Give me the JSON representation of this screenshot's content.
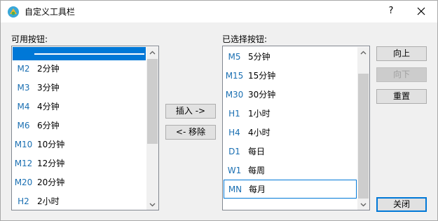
{
  "window": {
    "title": "自定义工具栏",
    "help_glyph": "?"
  },
  "left": {
    "label": "可用按钮:",
    "items": [
      {
        "code": "M2",
        "name": "2分钟"
      },
      {
        "code": "M3",
        "name": "3分钟"
      },
      {
        "code": "M4",
        "name": "4分钟"
      },
      {
        "code": "M6",
        "name": "6分钟"
      },
      {
        "code": "M10",
        "name": "10分钟"
      },
      {
        "code": "M12",
        "name": "12分钟"
      },
      {
        "code": "M20",
        "name": "20分钟"
      },
      {
        "code": "H2",
        "name": "2小时"
      }
    ]
  },
  "right": {
    "label": "已选择按钮:",
    "items": [
      {
        "code": "M5",
        "name": "5分钟"
      },
      {
        "code": "M15",
        "name": "15分钟"
      },
      {
        "code": "M30",
        "name": "30分钟"
      },
      {
        "code": "H1",
        "name": "1小时"
      },
      {
        "code": "H4",
        "name": "4小时"
      },
      {
        "code": "D1",
        "name": "每日"
      },
      {
        "code": "W1",
        "name": "每周"
      },
      {
        "code": "MN",
        "name": "每月"
      }
    ]
  },
  "buttons": {
    "insert": "插入 ->",
    "remove": "<- 移除",
    "move_up": "向上",
    "move_down": "向下",
    "reset": "重置",
    "close": "关闭"
  },
  "colors": {
    "accent": "#0078d7",
    "code_text": "#1a6fb2",
    "selection": "#0078d7"
  }
}
